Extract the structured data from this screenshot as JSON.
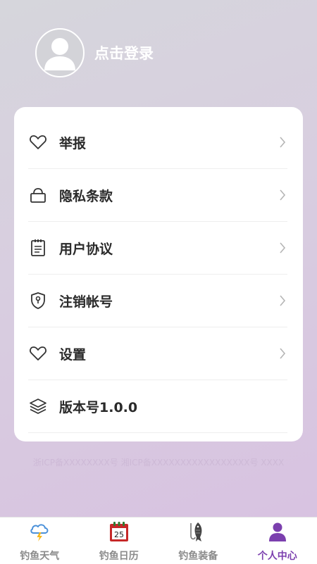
{
  "profile": {
    "login_label": "点击登录"
  },
  "menu": {
    "items": [
      {
        "label": "举报",
        "icon": "heart-icon",
        "has_chevron": true
      },
      {
        "label": "隐私条款",
        "icon": "bag-icon",
        "has_chevron": true
      },
      {
        "label": "用户协议",
        "icon": "clipboard-icon",
        "has_chevron": true
      },
      {
        "label": "注销帐号",
        "icon": "shield-icon",
        "has_chevron": true
      },
      {
        "label": "设置",
        "icon": "heart-icon",
        "has_chevron": true
      },
      {
        "label": "版本号1.0.0",
        "icon": "layers-icon",
        "has_chevron": false
      }
    ]
  },
  "footer": {
    "note": "浙ICP备XXXXXXXX号  湘ICP备XXXXXXXXXXXXXXXXX号  XXXX"
  },
  "tabs": [
    {
      "label": "钓鱼天气",
      "icon": "weather-icon",
      "active": false
    },
    {
      "label": "钓鱼日历",
      "icon": "calendar-icon",
      "active": false,
      "calendar_day": "25"
    },
    {
      "label": "钓鱼装备",
      "icon": "fish-icon",
      "active": false
    },
    {
      "label": "个人中心",
      "icon": "person-icon",
      "active": true
    }
  ],
  "colors": {
    "accent": "#7b3fae",
    "inactive": "#8a8a8a",
    "text": "#2a2a2a"
  }
}
